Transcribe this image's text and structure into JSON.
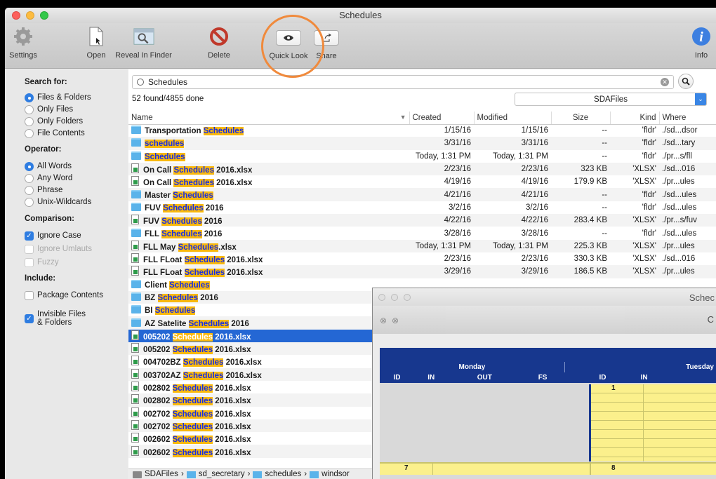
{
  "window": {
    "title": "Schedules"
  },
  "toolbar": {
    "settings": "Settings",
    "open": "Open",
    "reveal": "Reveal In Finder",
    "delete": "Delete",
    "quicklook": "Quick Look",
    "share": "Share",
    "info": "Info"
  },
  "sidebar": {
    "search_for": "Search for:",
    "files_folders": "Files & Folders",
    "only_files": "Only Files",
    "only_folders": "Only Folders",
    "file_contents": "File Contents",
    "operator": "Operator:",
    "all_words": "All Words",
    "any_word": "Any Word",
    "phrase": "Phrase",
    "unix": "Unix-Wildcards",
    "comparison": "Comparison:",
    "ignore_case": "Ignore Case",
    "ignore_umlauts": "Ignore Umlauts",
    "fuzzy": "Fuzzy",
    "include": "Include:",
    "package_contents": "Package Contents",
    "invisible_1": "Invisible Files",
    "invisible_2": "& Folders"
  },
  "search": {
    "value": "Schedules",
    "count": "52 found/4855 done",
    "volume": "SDAFiles"
  },
  "columns": {
    "name": "Name",
    "created": "Created",
    "modified": "Modified",
    "size": "Size",
    "kind": "Kind",
    "where": "Where"
  },
  "rows": [
    {
      "icon": "folder",
      "pre": "Transportation ",
      "hl": "Schedules",
      "post": "",
      "created": "1/15/16",
      "modified": "1/15/16",
      "size": "--",
      "kind": "'fldr'",
      "where": "./sd...dsor"
    },
    {
      "icon": "folder",
      "pre": "",
      "hl": "schedules",
      "post": "",
      "created": "3/31/16",
      "modified": "3/31/16",
      "size": "--",
      "kind": "'fldr'",
      "where": "./sd...tary"
    },
    {
      "icon": "folder",
      "pre": "",
      "hl": "Schedules",
      "post": "",
      "created": "Today, 1:31 PM",
      "modified": "Today, 1:31 PM",
      "size": "--",
      "kind": "'fldr'",
      "where": "./pr...s/fll"
    },
    {
      "icon": "doc",
      "pre": "On Call ",
      "hl": "Schedules",
      "post": " 2016.xlsx",
      "created": "2/23/16",
      "modified": "2/23/16",
      "size": "323 KB",
      "kind": "'XLSX'",
      "where": "./sd...016"
    },
    {
      "icon": "doc",
      "pre": "On Call ",
      "hl": "Schedules",
      "post": " 2016.xlsx",
      "created": "4/19/16",
      "modified": "4/19/16",
      "size": "179.9 KB",
      "kind": "'XLSX'",
      "where": "./pr...ules"
    },
    {
      "icon": "folder",
      "pre": "Master ",
      "hl": "Schedules",
      "post": "",
      "created": "4/21/16",
      "modified": "4/21/16",
      "size": "--",
      "kind": "'fldr'",
      "where": "./sd...ules"
    },
    {
      "icon": "folder",
      "pre": "FUV ",
      "hl": "Schedules",
      "post": " 2016",
      "created": "3/2/16",
      "modified": "3/2/16",
      "size": "--",
      "kind": "'fldr'",
      "where": "./sd...ules"
    },
    {
      "icon": "doc",
      "pre": "FUV ",
      "hl": "Schedules",
      "post": " 2016",
      "created": "4/22/16",
      "modified": "4/22/16",
      "size": "283.4 KB",
      "kind": "'XLSX'",
      "where": "./pr...s/fuv"
    },
    {
      "icon": "folder",
      "pre": "FLL ",
      "hl": "Schedules",
      "post": " 2016",
      "created": "3/28/16",
      "modified": "3/28/16",
      "size": "--",
      "kind": "'fldr'",
      "where": "./sd...ules"
    },
    {
      "icon": "doc",
      "pre": "FLL May ",
      "hl": "Schedules",
      "post": ".xlsx",
      "created": "Today, 1:31 PM",
      "modified": "Today, 1:31 PM",
      "size": "225.3 KB",
      "kind": "'XLSX'",
      "where": "./pr...ules"
    },
    {
      "icon": "doc",
      "pre": "FLL FLoat ",
      "hl": "Schedules",
      "post": " 2016.xlsx",
      "created": "2/23/16",
      "modified": "2/23/16",
      "size": "330.3 KB",
      "kind": "'XLSX'",
      "where": "./sd...016"
    },
    {
      "icon": "doc",
      "pre": "FLL FLoat ",
      "hl": "Schedules",
      "post": " 2016.xlsx",
      "created": "3/29/16",
      "modified": "3/29/16",
      "size": "186.5 KB",
      "kind": "'XLSX'",
      "where": "./pr...ules"
    },
    {
      "icon": "folder",
      "pre": "Client ",
      "hl": "Schedules",
      "post": "",
      "created": "",
      "modified": "",
      "size": "",
      "kind": "",
      "where": ""
    },
    {
      "icon": "folder",
      "pre": "BZ ",
      "hl": "Schedules",
      "post": " 2016",
      "created": "",
      "modified": "",
      "size": "",
      "kind": "",
      "where": ""
    },
    {
      "icon": "folder",
      "pre": "BI ",
      "hl": "Schedules",
      "post": "",
      "created": "",
      "modified": "",
      "size": "",
      "kind": "",
      "where": ""
    },
    {
      "icon": "folder",
      "pre": "AZ Satelite ",
      "hl": "Schedules",
      "post": " 2016",
      "created": "",
      "modified": "",
      "size": "",
      "kind": "",
      "where": ""
    },
    {
      "icon": "doc",
      "pre": "005202 ",
      "hl": "Schedules",
      "post": " 2016.xlsx",
      "created": "",
      "modified": "",
      "size": "",
      "kind": "",
      "where": "",
      "selected": true
    },
    {
      "icon": "doc",
      "pre": "005202 ",
      "hl": "Schedules",
      "post": " 2016.xlsx",
      "created": "",
      "modified": "",
      "size": "",
      "kind": "",
      "where": ""
    },
    {
      "icon": "doc",
      "pre": "004702BZ ",
      "hl": "Schedules",
      "post": " 2016.xlsx",
      "created": "",
      "modified": "",
      "size": "",
      "kind": "",
      "where": ""
    },
    {
      "icon": "doc",
      "pre": "003702AZ ",
      "hl": "Schedules",
      "post": " 2016.xlsx",
      "created": "",
      "modified": "",
      "size": "",
      "kind": "",
      "where": ""
    },
    {
      "icon": "doc",
      "pre": "002802 ",
      "hl": "Schedules",
      "post": " 2016.xlsx",
      "created": "",
      "modified": "",
      "size": "",
      "kind": "",
      "where": ""
    },
    {
      "icon": "doc",
      "pre": "002802 ",
      "hl": "Schedules",
      "post": " 2016.xlsx",
      "created": "",
      "modified": "",
      "size": "",
      "kind": "",
      "where": ""
    },
    {
      "icon": "doc",
      "pre": "002702 ",
      "hl": "Schedules",
      "post": " 2016.xlsx",
      "created": "",
      "modified": "",
      "size": "",
      "kind": "",
      "where": ""
    },
    {
      "icon": "doc",
      "pre": "002702 ",
      "hl": "Schedules",
      "post": " 2016.xlsx",
      "created": "",
      "modified": "",
      "size": "",
      "kind": "",
      "where": ""
    },
    {
      "icon": "doc",
      "pre": "002602 ",
      "hl": "Schedules",
      "post": " 2016.xlsx",
      "created": "",
      "modified": "",
      "size": "",
      "kind": "",
      "where": ""
    },
    {
      "icon": "doc",
      "pre": "002602 ",
      "hl": "Schedules",
      "post": " 2016.xlsx",
      "created": "",
      "modified": "",
      "size": "",
      "kind": "",
      "where": ""
    }
  ],
  "pathbar": [
    "SDAFiles",
    "sd_secretary",
    "schedules",
    "windsor"
  ],
  "quicklook": {
    "title": "Schec",
    "c_label": "C",
    "monday": "Monday",
    "tuesday": "Tuesday",
    "cols": [
      "ID",
      "IN",
      "OUT",
      "FS",
      "ID",
      "IN"
    ],
    "val1": "1",
    "val7": "7",
    "val8": "8"
  },
  "colors": {
    "accent": "#2467d4",
    "highlight": "#f9b90e",
    "ring": "#f08a3c"
  }
}
